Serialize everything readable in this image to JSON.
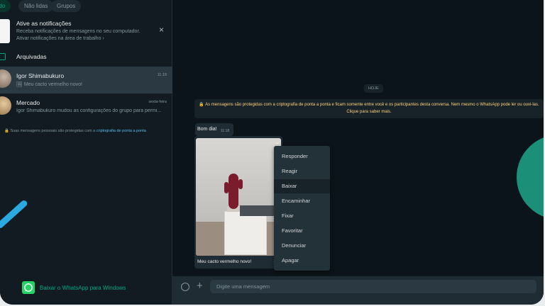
{
  "filters": {
    "items": [
      {
        "label": "udo",
        "active": true
      },
      {
        "label": "Não lidas",
        "active": false
      },
      {
        "label": "Grupos",
        "active": false
      }
    ]
  },
  "notification": {
    "title": "Ative as notificações",
    "line1": "Receba notificações de mensagens no seu computador.",
    "line2": "Ativar notificações na área de trabalho ›",
    "close_icon": "×"
  },
  "archived": {
    "label": "Arquivadas"
  },
  "chats": [
    {
      "name": "Igor Shimabukuro",
      "time": "11:18",
      "preview": "🖼 Meu cacto vermelho novo!",
      "selected": true
    },
    {
      "name": "Mercado",
      "time": "sexta-feira",
      "preview": "Igor Shimabukuro mudou as configurações do grupo para permi...",
      "selected": false
    }
  ],
  "encryption_note": {
    "text": "🔒 Suas mensagens pessoais são protegidas com a ",
    "link": "criptografia de ponta a ponta"
  },
  "download": {
    "label": "Baixar o WhatsApp para Windows"
  },
  "conversation": {
    "date_chip": "HOJE",
    "system_message": "🔒 As mensagens são protegidas com a criptografia de ponta a ponta e ficam somente entre você e os participantes desta conversa. Nem mesmo o WhatsApp pode ler ou ouvi-las. Clique para saber mais.",
    "text_message": {
      "body": "Bom dia!",
      "time": "11:18"
    },
    "image_message": {
      "caption": "Meu cacto vermelho novo!",
      "time_partial": "1"
    }
  },
  "context_menu": {
    "items": [
      "Responder",
      "Reagir",
      "Baixar",
      "Encaminhar",
      "Fixar",
      "Favoritar",
      "Denunciar",
      "Apagar"
    ],
    "hover_index": 2
  },
  "composer": {
    "placeholder": "Digite uma mensagem"
  },
  "colors": {
    "accent": "#00a884",
    "panel": "#111b21",
    "chat_bg": "#0b141a",
    "system_text": "#ffd279"
  }
}
